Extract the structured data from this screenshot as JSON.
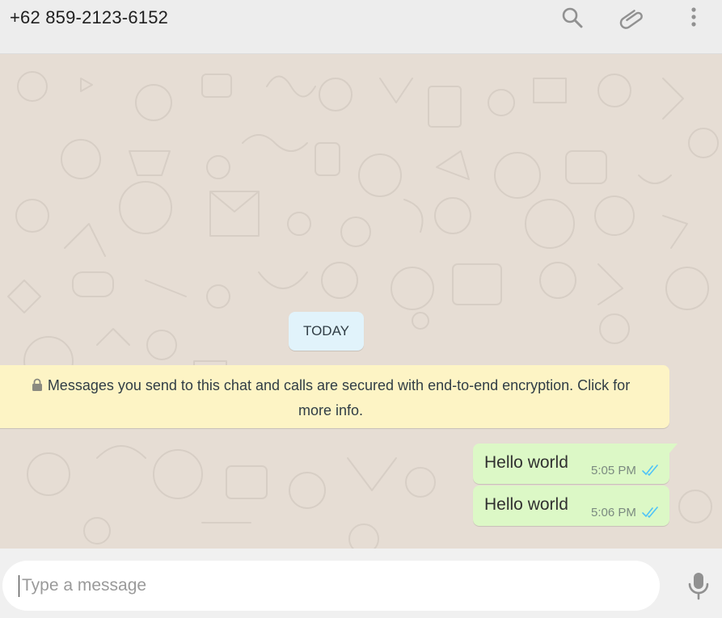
{
  "header": {
    "contact_name": "+62 859-2123-6152",
    "icons": [
      "search-icon",
      "attach-icon",
      "menu-icon"
    ]
  },
  "chat": {
    "date_divider": "TODAY",
    "encryption_notice": "Messages you send to this chat and calls are secured with end-to-end encryption. Click for more info.",
    "messages": [
      {
        "text": "Hello world",
        "time": "5:05 PM",
        "status": "read"
      },
      {
        "text": "Hello world",
        "time": "5:06 PM",
        "status": "read"
      }
    ]
  },
  "composer": {
    "placeholder": "Type a message",
    "value": ""
  },
  "colors": {
    "header_bg": "#ededed",
    "chat_bg": "#e6ddd4",
    "outgoing_bubble": "#dcf8c6",
    "notice_bg": "#fdf4c5",
    "date_chip_bg": "#e1f3fb",
    "read_ticks": "#4fc3f7",
    "icon_gray": "#919191"
  }
}
